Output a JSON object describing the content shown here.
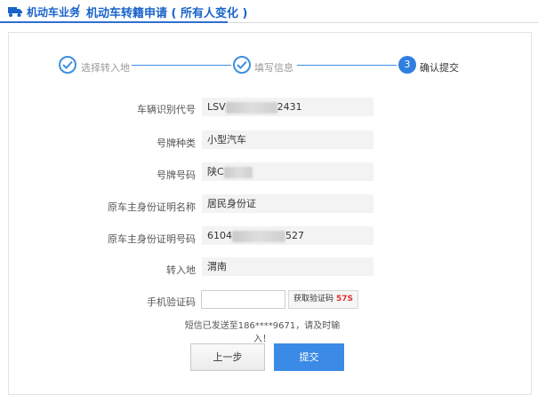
{
  "breadcrumb": {
    "root": "机动车业务",
    "separator": "/",
    "current": "机动车转籍申请 ( 所有人变化 )"
  },
  "steps": [
    {
      "label": "选择转入地",
      "state": "done"
    },
    {
      "label": "填写信息",
      "state": "done"
    },
    {
      "label": "确认提交",
      "state": "active",
      "number": "3"
    }
  ],
  "form": {
    "vin": {
      "label": "车辆识别代号",
      "prefix": "LSV",
      "suffix": "2431"
    },
    "plate_type": {
      "label": "号牌种类",
      "value": "小型汽车"
    },
    "plate_no": {
      "label": "号牌号码",
      "prefix": "陕C"
    },
    "id_type": {
      "label": "原车主身份证明名称",
      "value": "居民身份证"
    },
    "id_no": {
      "label": "原车主身份证明号码",
      "prefix": "6104",
      "suffix": "527"
    },
    "dest": {
      "label": "转入地",
      "value": "渭南"
    },
    "phone_code": {
      "label": "手机验证码",
      "value": ""
    }
  },
  "code_button": {
    "label": "获取验证码",
    "countdown": "57S"
  },
  "sms_message": "短信已发送至186****9671，请及时输入！",
  "buttons": {
    "prev": "上一步",
    "submit": "提交"
  },
  "colors": {
    "accent": "#2f7fe0",
    "countdown": "#e23232"
  }
}
